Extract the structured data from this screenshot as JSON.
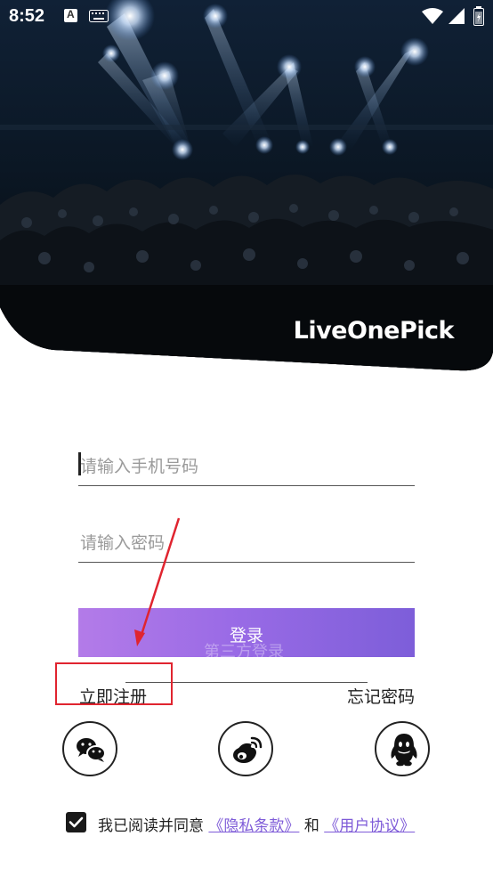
{
  "status_bar": {
    "time": "8:52",
    "notification_badge": "A",
    "icons": [
      "app-notification-icon",
      "keyboard-icon",
      "wifi-icon",
      "signal-icon",
      "battery-icon"
    ]
  },
  "hero": {
    "brand": "LiveOnePick",
    "image": "concert-stage-lights"
  },
  "form": {
    "phone_placeholder": "请输入手机号码",
    "password_placeholder": "请输入密码",
    "login_label": "登录",
    "third_party_label": "第三方登录",
    "register_label": "立即注册",
    "forgot_label": "忘记密码"
  },
  "social": [
    "wechat-icon",
    "weibo-icon",
    "qq-icon"
  ],
  "agreement": {
    "checked": true,
    "prefix": "我已阅读并同意",
    "privacy_link": "《隐私条款》",
    "conjunction": "和",
    "terms_link": "《用户协议》"
  },
  "colors": {
    "button_start": "#b37be8",
    "button_end": "#7d5ed9",
    "link": "#7e5bd8",
    "annotation": "#e0242f"
  }
}
